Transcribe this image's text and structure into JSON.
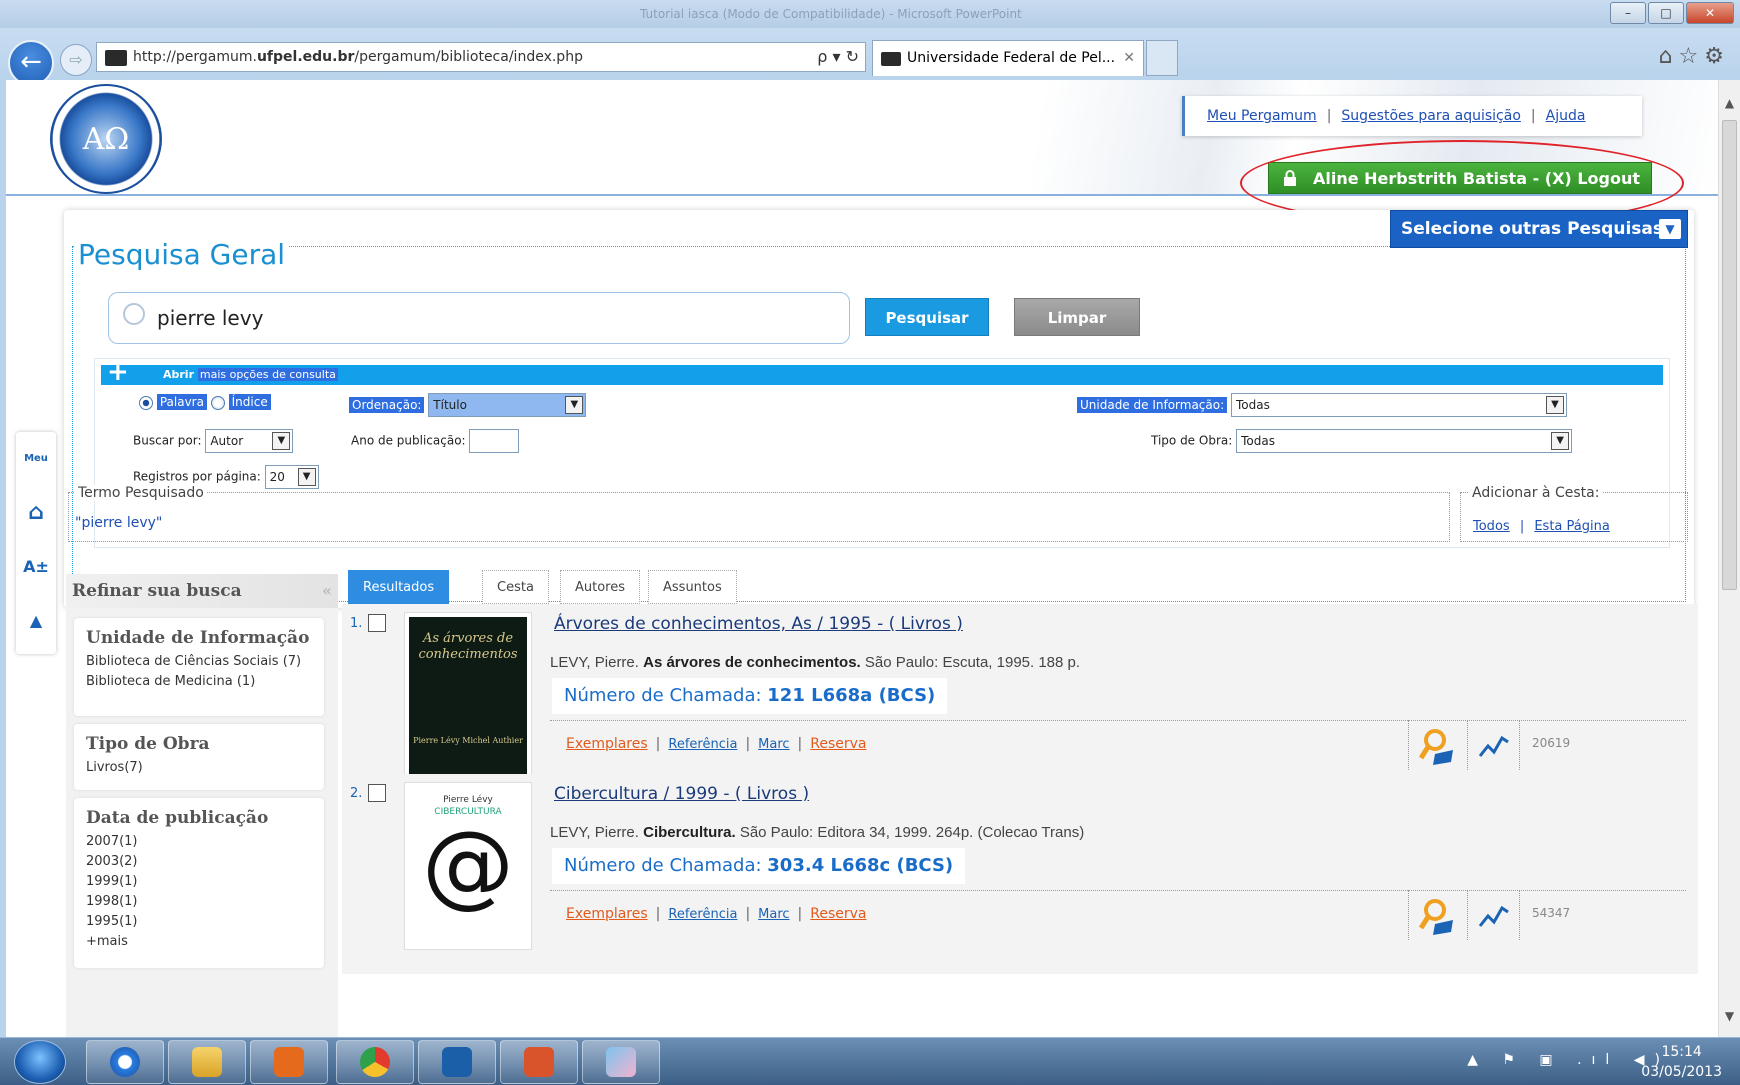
{
  "browser": {
    "window_title": "Tutorial iasca (Modo de Compatibilidade) - Microsoft PowerPoint",
    "url_prefix": "http://pergamum.",
    "url_domain": "ufpel.edu.br",
    "url_path": "/pergamum/biblioteca/index.php",
    "address_tools": "ρ ▾ ↻",
    "tab_title": "Universidade Federal de Pel...",
    "tab_close": "✕",
    "toolbar_icons": "⌂☆⚙",
    "win_minimize": "–",
    "win_maximize": "□",
    "win_close": "✕"
  },
  "header": {
    "logo_text": "ΑΩ",
    "links": [
      "Meu Pergamum",
      "Sugestões para aquisição",
      "Ajuda"
    ],
    "separator": "|",
    "user_button": "Aline Herbstrith Batista - (X) Logout"
  },
  "sidebar": {
    "items": [
      "Meu",
      "⌂",
      "A±",
      "▲"
    ]
  },
  "search": {
    "title": "Pesquisa Geral",
    "other_searches": "Selecione outras Pesquisas",
    "query": "pierre levy",
    "search_button": "Pesquisar",
    "clear_button": "Limpar",
    "options_bar_prefix": "Abrir",
    "options_bar_link": "mais opções de consulta",
    "radio_palavra": "Palavra",
    "radio_indice": "Índice",
    "ordenacao_label": "Ordenação:",
    "ordenacao_value": "Título",
    "unidade_label": "Unidade de Informação:",
    "unidade_value": "Todas",
    "buscar_por_label": "Buscar por:",
    "buscar_por_value": "Autor",
    "ano_label": "Ano de publicação:",
    "tipo_obra_label": "Tipo de Obra:",
    "tipo_obra_value": "Todas",
    "registros_label": "Registros por página:",
    "registros_value": "20"
  },
  "termo": {
    "label": "Termo Pesquisado",
    "value": "\"pierre levy\""
  },
  "cesta": {
    "label": "Adicionar à Cesta:",
    "todos": "Todos",
    "esta_pagina": "Esta Página",
    "separator": "|"
  },
  "refine": {
    "title": "Refinar sua busca",
    "collapse": "«",
    "unidade_title": "Unidade de Informação",
    "unidade_items": [
      "Biblioteca de Ciências Sociais (7)",
      "Biblioteca de Medicina (1)"
    ],
    "tipo_title": "Tipo de Obra",
    "tipo_items": [
      "Livros(7)"
    ],
    "data_title": "Data de publicação",
    "data_items": [
      "2007(1)",
      "2003(2)",
      "1999(1)",
      "1998(1)",
      "1995(1)",
      "+mais"
    ]
  },
  "tabs": [
    "Resultados \"7\"",
    "Cesta",
    "Autores",
    "Assuntos"
  ],
  "records": [
    {
      "num": "1.",
      "title": "Árvores de conhecimentos, As / 1995 - ( Livros )",
      "author": "LEVY, Pierre.",
      "work": "As árvores de conhecimentos.",
      "imprint": "São Paulo: Escuta, 1995. 188 p.",
      "chamada_label": "Número de Chamada:",
      "chamada_value": "121 L668a (BCS)",
      "cover_title": "As árvores de conhecimentos",
      "cover_authors": "Pierre Lévy Michel Authier",
      "code": "20619"
    },
    {
      "num": "2.",
      "title": "Cibercultura / 1999 - ( Livros )",
      "author": "LEVY, Pierre.",
      "work": "Cibercultura.",
      "imprint": "São Paulo: Editora 34, 1999. 264p. (Colecao Trans)",
      "chamada_label": "Número de Chamada:",
      "chamada_value": "303.4 L668c (BCS)",
      "cover_title": "CIBERCULTURA",
      "cover_authors": "Pierre Lévy",
      "code": "54347"
    }
  ],
  "record_links": [
    "Exemplares",
    "Referência",
    "Marc",
    "Reserva"
  ],
  "taskbar": {
    "tray": "▲ ⚑ ▣ .ıl ◀)",
    "time": "15:14",
    "date": "03/05/2013"
  },
  "colors": {
    "accent": "#1a9ae0",
    "logout_green": "#2f8f25",
    "annotation_red": "#e0232a",
    "link_orange": "#e25a1c"
  }
}
